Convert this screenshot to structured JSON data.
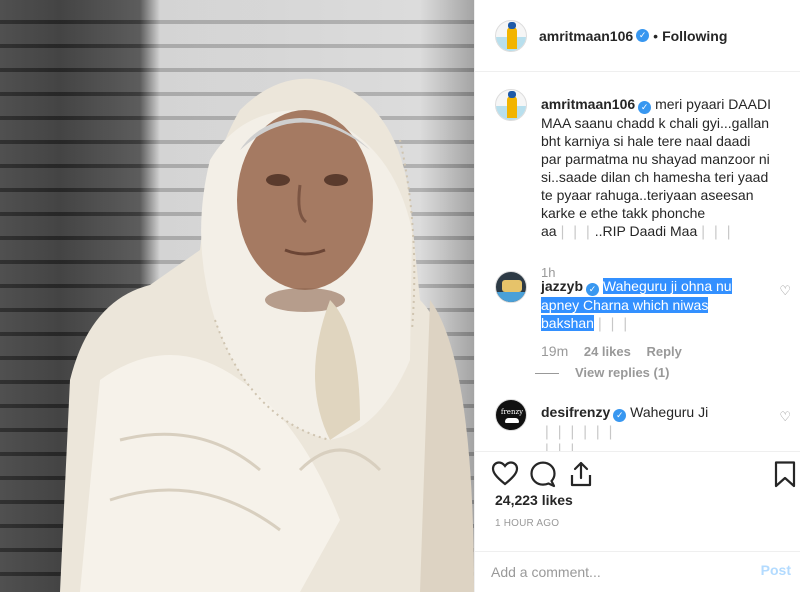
{
  "header": {
    "username": "amritmaan106",
    "separator": "•",
    "follow_state": "Following"
  },
  "caption": {
    "username": "amritmaan106",
    "text": "meri pyaari DAADI MAA saanu chadd k chali gyi...gallan bht karniya si hale tere naal daadi par parmatma nu shayad manzoor ni si..saade dilan ch hamesha teri yaad te pyaar rahuga..teriyaan aseesan karke e ethe takk phonche aa",
    "tail_emoji": "❘❘❘",
    "tail_text": "..RIP Daadi Maa",
    "tail_emoji2": "❘❘❘",
    "time": "1h"
  },
  "comments": [
    {
      "username": "jazzyb",
      "text_line1": "Waheguru ji ohna nu",
      "text_line2": "apney Charna which niwas",
      "text_line3": "bakshan",
      "tail_emoji": "❘❘❘",
      "time": "19m",
      "likes": "24 likes",
      "reply": "Reply",
      "view_replies": "View replies (1)"
    },
    {
      "username": "desifrenzy",
      "text": "Waheguru Ji",
      "tail_emoji": "❘❘❘❘❘❘",
      "tail_emoji2": "❘❘❘"
    }
  ],
  "actions": {
    "likes": "24,223 likes",
    "time_ago": "1 HOUR AGO"
  },
  "add_comment": {
    "placeholder": "Add a comment...",
    "post_label": "Post"
  },
  "icons": {
    "verified": "verified-badge-icon",
    "heart": "heart-icon",
    "comment": "comment-icon",
    "share": "share-icon",
    "save": "bookmark-icon"
  },
  "colors": {
    "verified_blue": "#3897f0",
    "selection_blue": "#3390ff",
    "post_disabled": "#b3dbff"
  }
}
